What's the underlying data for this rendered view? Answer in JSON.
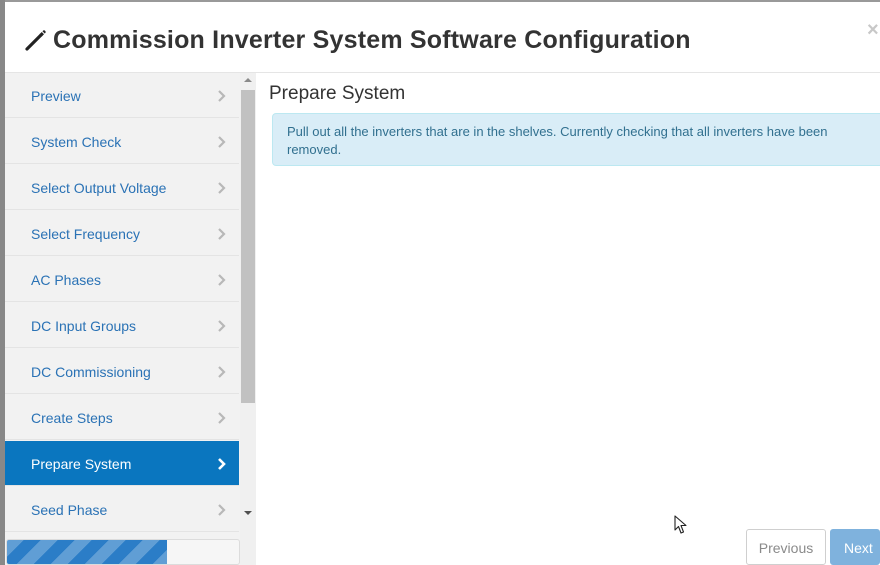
{
  "dialog": {
    "title": "Commission Inverter System Software Configuration",
    "close_symbol": "×",
    "icons": {
      "title": "magic-wand-icon",
      "close": "close-icon"
    }
  },
  "sidebar": {
    "items": [
      {
        "label": "Preview",
        "active": false
      },
      {
        "label": "System Check",
        "active": false
      },
      {
        "label": "Select Output Voltage",
        "active": false
      },
      {
        "label": "Select Frequency",
        "active": false
      },
      {
        "label": "AC Phases",
        "active": false
      },
      {
        "label": "DC Input Groups",
        "active": false
      },
      {
        "label": "DC Commissioning",
        "active": false
      },
      {
        "label": "Create Steps",
        "active": false
      },
      {
        "label": "Prepare System",
        "active": true
      },
      {
        "label": "Seed Phase",
        "active": false
      }
    ],
    "item_icon": "chevron-right-icon",
    "progress_fraction": 0.69
  },
  "main": {
    "heading": "Prepare System",
    "alert": "Pull out all the inverters that are in the shelves. Currently checking that all inverters have been removed."
  },
  "footer": {
    "previous_label": "Previous",
    "next_label": "Next"
  },
  "colors": {
    "active_nav": "#0a76bf",
    "link": "#2a72b5",
    "alert_bg": "#d9edf7",
    "alert_text": "#31708f",
    "next_button": "#7fb2dd",
    "progress": "#2b7dc7"
  }
}
